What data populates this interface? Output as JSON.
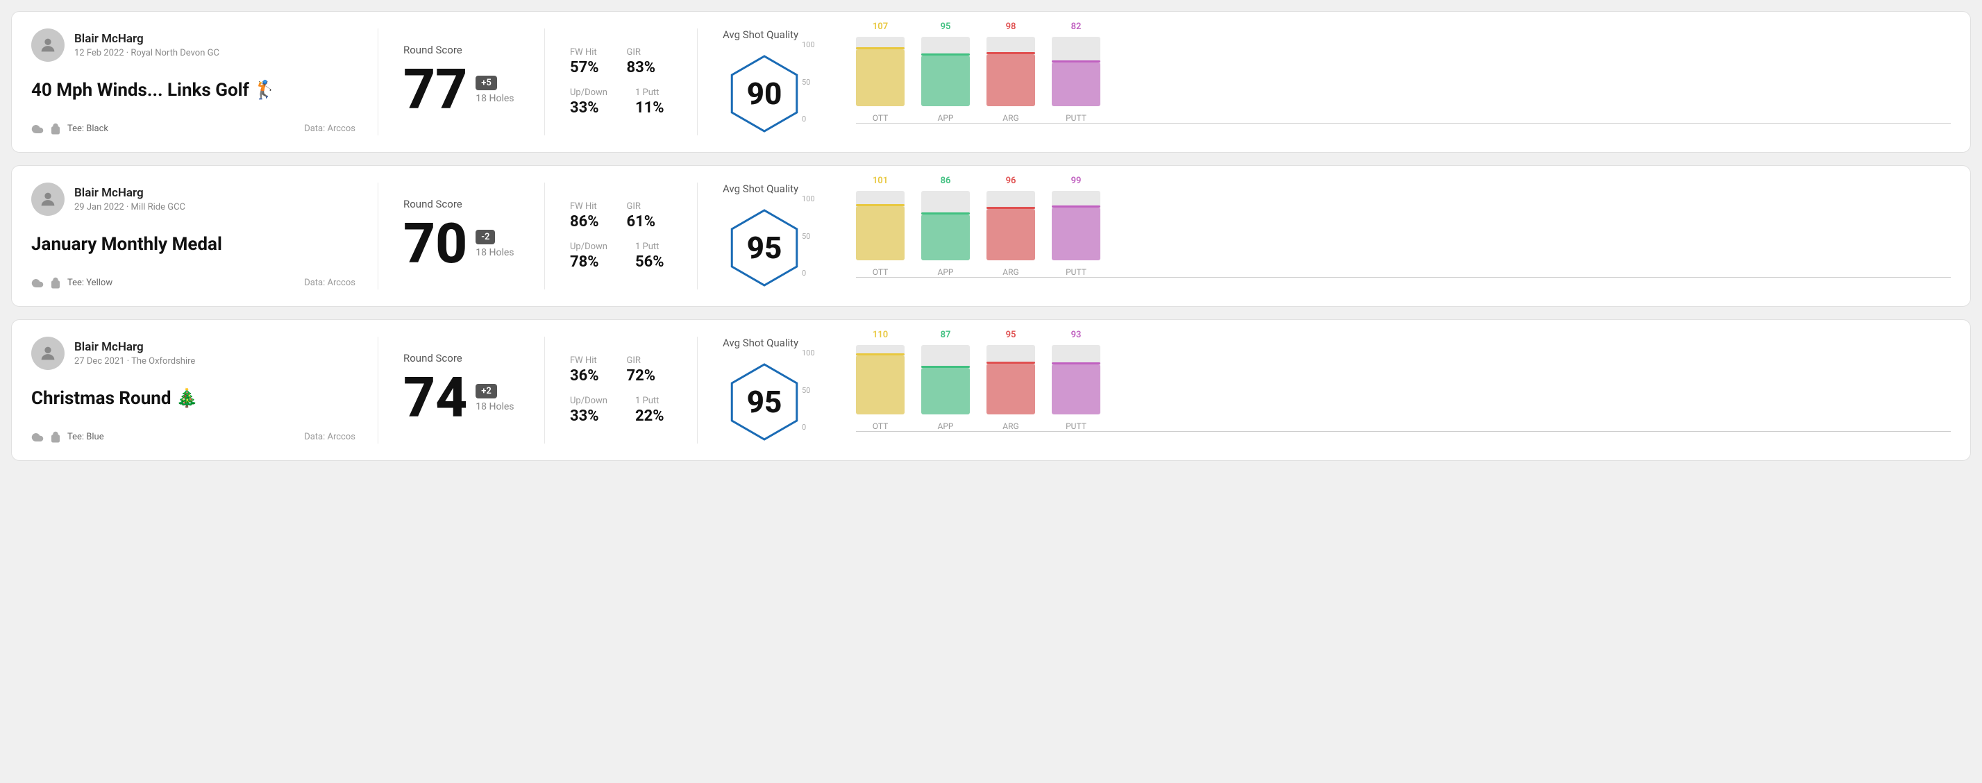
{
  "rounds": [
    {
      "id": "round1",
      "user": {
        "name": "Blair McHarg",
        "meta": "12 Feb 2022 · Royal North Devon GC"
      },
      "title": "40 Mph Winds... Links Golf 🏌️",
      "tee": "Black",
      "data_source": "Data: Arccos",
      "round_score_label": "Round Score",
      "score": "77",
      "badge": "+5",
      "holes": "18 Holes",
      "fw_hit_label": "FW Hit",
      "fw_hit": "57%",
      "gir_label": "GIR",
      "gir": "83%",
      "updown_label": "Up/Down",
      "updown": "33%",
      "oneputt_label": "1 Putt",
      "oneputt": "11%",
      "avg_shot_quality_label": "Avg Shot Quality",
      "quality_score": "90",
      "bars": [
        {
          "label": "OTT",
          "value": 107,
          "color": "#e8c840"
        },
        {
          "label": "APP",
          "value": 95,
          "color": "#40c080"
        },
        {
          "label": "ARG",
          "value": 98,
          "color": "#e05050"
        },
        {
          "label": "PUTT",
          "value": 82,
          "color": "#c060c0"
        }
      ]
    },
    {
      "id": "round2",
      "user": {
        "name": "Blair McHarg",
        "meta": "29 Jan 2022 · Mill Ride GCC"
      },
      "title": "January Monthly Medal",
      "tee": "Yellow",
      "data_source": "Data: Arccos",
      "round_score_label": "Round Score",
      "score": "70",
      "badge": "-2",
      "holes": "18 Holes",
      "fw_hit_label": "FW Hit",
      "fw_hit": "86%",
      "gir_label": "GIR",
      "gir": "61%",
      "updown_label": "Up/Down",
      "updown": "78%",
      "oneputt_label": "1 Putt",
      "oneputt": "56%",
      "avg_shot_quality_label": "Avg Shot Quality",
      "quality_score": "95",
      "bars": [
        {
          "label": "OTT",
          "value": 101,
          "color": "#e8c840"
        },
        {
          "label": "APP",
          "value": 86,
          "color": "#40c080"
        },
        {
          "label": "ARG",
          "value": 96,
          "color": "#e05050"
        },
        {
          "label": "PUTT",
          "value": 99,
          "color": "#c060c0"
        }
      ]
    },
    {
      "id": "round3",
      "user": {
        "name": "Blair McHarg",
        "meta": "27 Dec 2021 · The Oxfordshire"
      },
      "title": "Christmas Round 🎄",
      "tee": "Blue",
      "data_source": "Data: Arccos",
      "round_score_label": "Round Score",
      "score": "74",
      "badge": "+2",
      "holes": "18 Holes",
      "fw_hit_label": "FW Hit",
      "fw_hit": "36%",
      "gir_label": "GIR",
      "gir": "72%",
      "updown_label": "Up/Down",
      "updown": "33%",
      "oneputt_label": "1 Putt",
      "oneputt": "22%",
      "avg_shot_quality_label": "Avg Shot Quality",
      "quality_score": "95",
      "bars": [
        {
          "label": "OTT",
          "value": 110,
          "color": "#e8c840"
        },
        {
          "label": "APP",
          "value": 87,
          "color": "#40c080"
        },
        {
          "label": "ARG",
          "value": 95,
          "color": "#e05050"
        },
        {
          "label": "PUTT",
          "value": 93,
          "color": "#c060c0"
        }
      ]
    }
  ],
  "chart": {
    "y_labels": [
      "100",
      "50",
      "0"
    ]
  }
}
